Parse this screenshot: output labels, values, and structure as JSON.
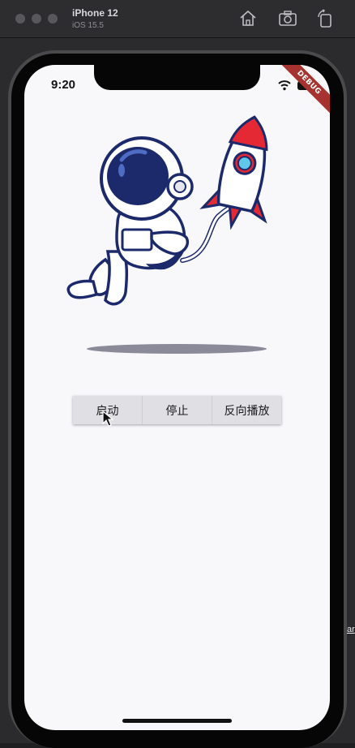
{
  "simulator": {
    "device_name": "iPhone 12",
    "os_version": "iOS 15.5",
    "toolbar_icons": [
      "home-icon",
      "screenshot-icon",
      "rotate-icon"
    ]
  },
  "status_bar": {
    "time": "9:20",
    "icons": [
      "wifi-icon",
      "battery-icon"
    ]
  },
  "debug_banner": "DEBUG",
  "controls": {
    "buttons": [
      {
        "label": "启动"
      },
      {
        "label": "停止"
      },
      {
        "label": "反向播放"
      }
    ]
  },
  "side_link": "ar",
  "colors": {
    "screen_bg": "#f8f7fa",
    "button_bg": "#e0dfe3",
    "astronaut_navy": "#1c2a6b",
    "rocket_red": "#e42934",
    "shadow": "#8b8a98"
  }
}
